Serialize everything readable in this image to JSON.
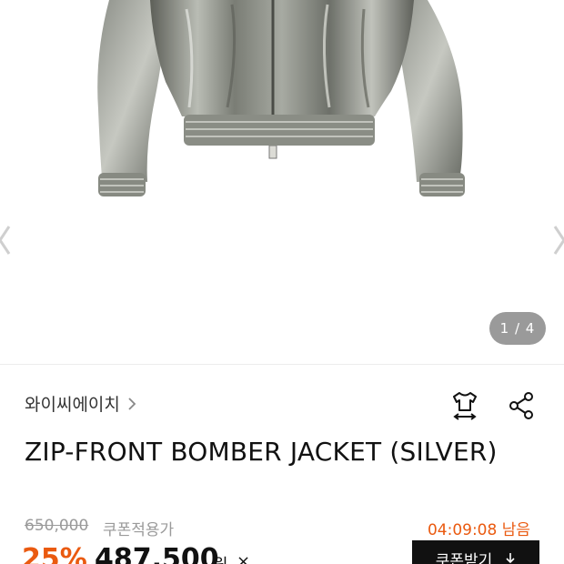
{
  "gallery": {
    "counter": "1 / 4",
    "image_alt": "silver metallic zip-front bomber jacket"
  },
  "brand": {
    "name": "와이씨에이치",
    "chevron_icon": "chevron-right-icon"
  },
  "actions": {
    "size_icon": "shirt-size-icon",
    "share_icon": "share-icon"
  },
  "product": {
    "title": "ZIP-FRONT BOMBER JACKET (SILVER)"
  },
  "pricing": {
    "original_price": "650,000",
    "coupon_label": "쿠폰적용가",
    "timer": "04:09:08 남음",
    "discount": "25%",
    "sale_price": "487,500",
    "currency": "원",
    "info_mark": "×",
    "coupon_button": "쿠폰받기"
  },
  "colors": {
    "accent": "#ea5a10",
    "button_bg": "#111111",
    "muted_text": "#9a9a9a"
  }
}
